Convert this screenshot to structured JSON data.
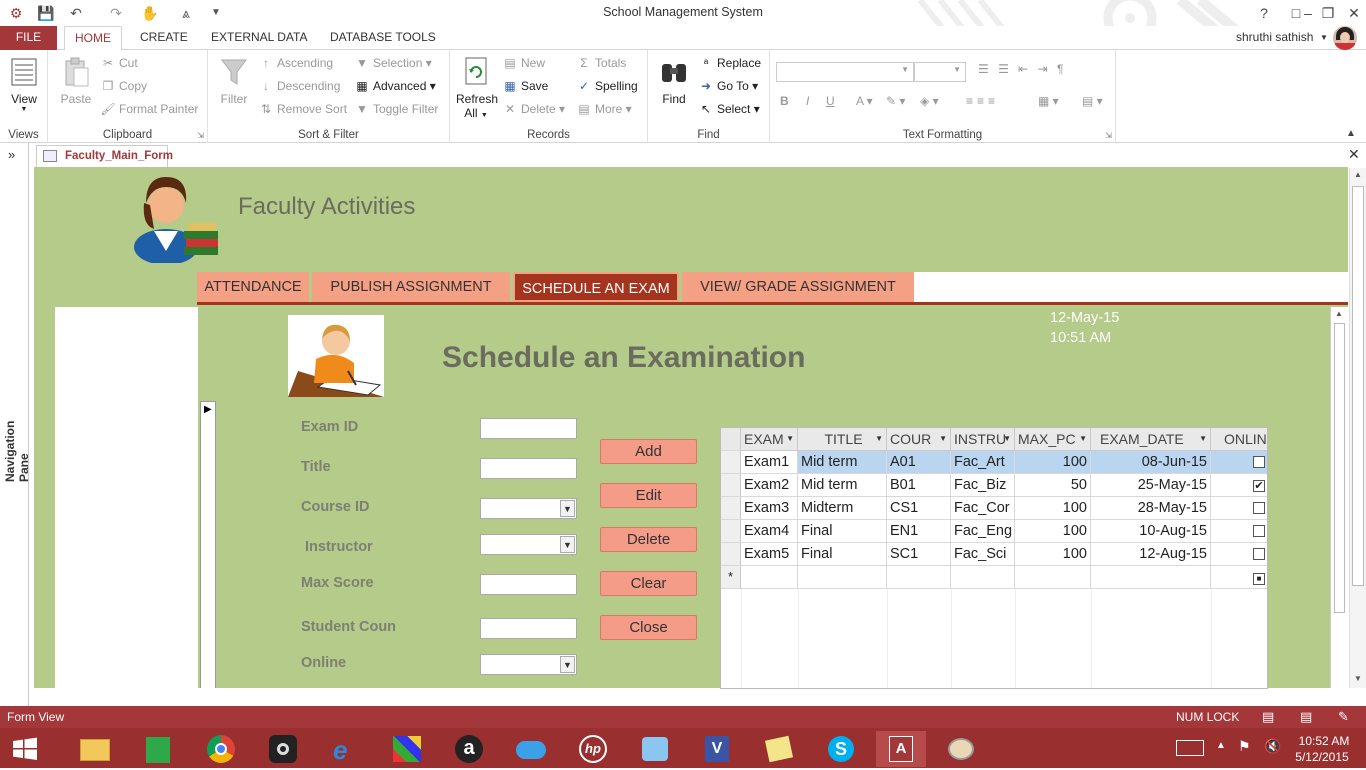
{
  "window": {
    "title": "School Management System",
    "help": "?",
    "user": "shruthi sathish"
  },
  "ribbon_tabs": [
    "FILE",
    "HOME",
    "CREATE",
    "EXTERNAL DATA",
    "DATABASE TOOLS"
  ],
  "ribbon": {
    "views": {
      "view": "View",
      "label": "Views"
    },
    "clipboard": {
      "paste": "Paste",
      "cut": "Cut",
      "copy": "Copy",
      "format_painter": "Format Painter",
      "label": "Clipboard"
    },
    "sort_filter": {
      "filter": "Filter",
      "ascending": "Ascending",
      "descending": "Descending",
      "remove_sort": "Remove Sort",
      "selection": "Selection",
      "advanced": "Advanced",
      "toggle_filter": "Toggle Filter",
      "label": "Sort & Filter"
    },
    "records": {
      "refresh": "Refresh",
      "refresh_all": "All",
      "new": "New",
      "save": "Save",
      "delete": "Delete",
      "totals": "Totals",
      "spelling": "Spelling",
      "more": "More",
      "label": "Records"
    },
    "find": {
      "find": "Find",
      "replace": "Replace",
      "goto": "Go To",
      "select": "Select",
      "label": "Find"
    },
    "text_formatting": {
      "label": "Text Formatting"
    }
  },
  "navigation_pane": {
    "label": "Navigation Pane"
  },
  "document_tab": {
    "label": "Faculty_Main_Form"
  },
  "form": {
    "header_title": "Faculty Activities",
    "tabs": [
      "ATTENDANCE",
      "PUBLISH ASSIGNMENT",
      "SCHEDULE AN EXAM",
      "VIEW/ GRADE ASSIGNMENT"
    ],
    "active_tab": "SCHEDULE AN EXAM",
    "page_title": "Schedule an Examination",
    "date": "12-May-15",
    "time": "10:51 AM",
    "fields": [
      {
        "label": "Exam ID",
        "kind": "text",
        "value": ""
      },
      {
        "label": "Title",
        "kind": "text",
        "value": ""
      },
      {
        "label": "Course ID",
        "kind": "combo",
        "value": ""
      },
      {
        "label": " Instructor",
        "kind": "combo",
        "value": ""
      },
      {
        "label": "Max Score",
        "kind": "text",
        "value": ""
      },
      {
        "label": "Student Coun",
        "kind": "text",
        "value": ""
      },
      {
        "label": "Online",
        "kind": "combo",
        "value": ""
      }
    ],
    "buttons": [
      "Add",
      "Edit",
      "Delete",
      "Clear",
      "Close"
    ]
  },
  "datasheet": {
    "columns": [
      "EXAM",
      "TITLE",
      "COUR",
      "INSTRU",
      "MAX_PC",
      "EXAM_DATE",
      "ONLIN"
    ],
    "rows": [
      {
        "exam": "Exam1",
        "title": "Mid term",
        "course": "A01",
        "instructor": "Fac_Art",
        "max": "100",
        "date": "08-Jun-15",
        "online": false
      },
      {
        "exam": "Exam2",
        "title": "Mid term",
        "course": "B01",
        "instructor": "Fac_Biz",
        "max": "50",
        "date": "25-May-15",
        "online": true
      },
      {
        "exam": "Exam3",
        "title": "Midterm",
        "course": "CS1",
        "instructor": "Fac_Cor",
        "max": "100",
        "date": "28-May-15",
        "online": false
      },
      {
        "exam": "Exam4",
        "title": "Final",
        "course": "EN1",
        "instructor": "Fac_Eng",
        "max": "100",
        "date": "10-Aug-15",
        "online": false
      },
      {
        "exam": "Exam5",
        "title": "Final",
        "course": "SC1",
        "instructor": "Fac_Sci",
        "max": "100",
        "date": "12-Aug-15",
        "online": false
      }
    ],
    "new_row_marker": "*",
    "selected_row": 0
  },
  "status_bar": {
    "view": "Form View",
    "numlock": "NUM LOCK"
  },
  "taskbar": {
    "time": "10:52 AM",
    "date": "5/12/2015"
  },
  "colors": {
    "accent": "#a4373a",
    "form_bg": "#b4cb8a",
    "tab_bg": "#f4a084",
    "tab_active": "#a4341e",
    "button_bg": "#f49c88"
  }
}
